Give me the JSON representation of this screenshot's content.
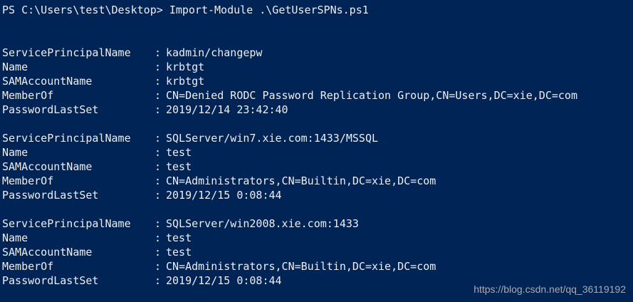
{
  "prompt": {
    "path": "PS C:\\Users\\test\\Desktop>",
    "command": "Import-Module .\\GetUserSPNs.ps1"
  },
  "separator": ":",
  "records": [
    {
      "fields": [
        {
          "name": "ServicePrincipalName",
          "value": "kadmin/changepw"
        },
        {
          "name": "Name",
          "value": "krbtgt"
        },
        {
          "name": "SAMAccountName",
          "value": "krbtgt"
        },
        {
          "name": "MemberOf",
          "value": "CN=Denied RODC Password Replication Group,CN=Users,DC=xie,DC=com"
        },
        {
          "name": "PasswordLastSet",
          "value": "2019/12/14 23:42:40"
        }
      ]
    },
    {
      "fields": [
        {
          "name": "ServicePrincipalName",
          "value": "SQLServer/win7.xie.com:1433/MSSQL"
        },
        {
          "name": "Name",
          "value": "test"
        },
        {
          "name": "SAMAccountName",
          "value": "test"
        },
        {
          "name": "MemberOf",
          "value": "CN=Administrators,CN=Builtin,DC=xie,DC=com"
        },
        {
          "name": "PasswordLastSet",
          "value": "2019/12/15 0:08:44"
        }
      ]
    },
    {
      "fields": [
        {
          "name": "ServicePrincipalName",
          "value": "SQLServer/win2008.xie.com:1433"
        },
        {
          "name": "Name",
          "value": "test"
        },
        {
          "name": "SAMAccountName",
          "value": "test"
        },
        {
          "name": "MemberOf",
          "value": "CN=Administrators,CN=Builtin,DC=xie,DC=com"
        },
        {
          "name": "PasswordLastSet",
          "value": "2019/12/15 0:08:44"
        }
      ]
    }
  ],
  "watermark": "https://blog.csdn.net/qq_36119192",
  "colors": {
    "background": "#012456",
    "foreground": "#eeedf0",
    "watermark": "#a9a9b3"
  }
}
